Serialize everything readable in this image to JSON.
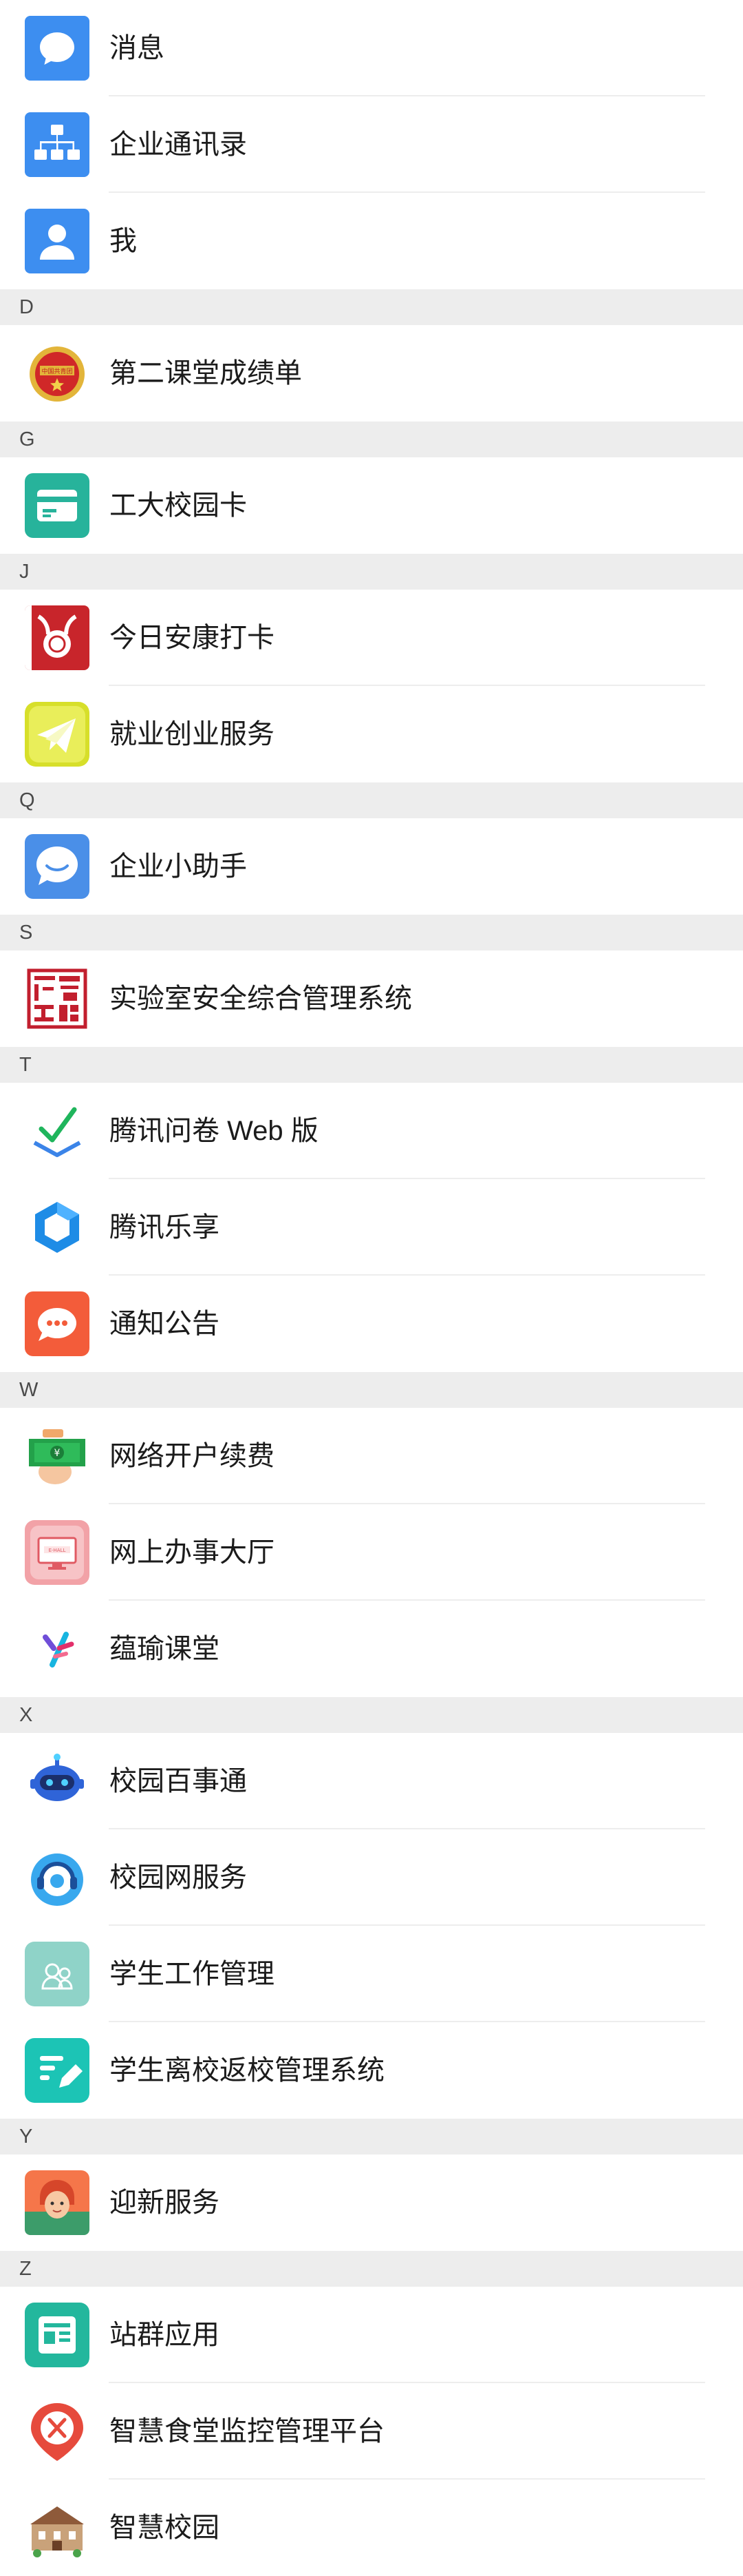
{
  "sections": [
    {
      "letter": "",
      "items": [
        {
          "label": "消息",
          "icon": "message-icon"
        },
        {
          "label": "企业通讯录",
          "icon": "org-chart-icon"
        },
        {
          "label": "我",
          "icon": "user-icon"
        }
      ]
    },
    {
      "letter": "D",
      "items": [
        {
          "label": "第二课堂成绩单",
          "icon": "youth-league-badge-icon"
        }
      ]
    },
    {
      "letter": "G",
      "items": [
        {
          "label": "工大校园卡",
          "icon": "campus-card-icon"
        }
      ]
    },
    {
      "letter": "J",
      "items": [
        {
          "label": "今日安康打卡",
          "icon": "health-checkin-icon"
        },
        {
          "label": "就业创业服务",
          "icon": "paper-plane-icon"
        }
      ]
    },
    {
      "letter": "Q",
      "items": [
        {
          "label": "企业小助手",
          "icon": "assistant-bubble-icon"
        }
      ]
    },
    {
      "letter": "S",
      "items": [
        {
          "label": "实验室安全综合管理系统",
          "icon": "lab-seal-icon"
        }
      ]
    },
    {
      "letter": "T",
      "items": [
        {
          "label": "腾讯问卷 Web 版",
          "icon": "survey-check-icon"
        },
        {
          "label": "腾讯乐享",
          "icon": "lexiang-hexagon-icon"
        },
        {
          "label": "通知公告",
          "icon": "announcement-bubble-icon"
        }
      ]
    },
    {
      "letter": "W",
      "items": [
        {
          "label": "网络开户续费",
          "icon": "payment-cash-icon"
        },
        {
          "label": "网上办事大厅",
          "icon": "online-hall-icon"
        },
        {
          "label": "蕴瑜课堂",
          "icon": "yunyu-logo-icon"
        }
      ]
    },
    {
      "letter": "X",
      "items": [
        {
          "label": "校园百事通",
          "icon": "robot-icon"
        },
        {
          "label": "校园网服务",
          "icon": "headset-icon"
        },
        {
          "label": "学生工作管理",
          "icon": "student-work-icon"
        },
        {
          "label": "学生离校返校管理系统",
          "icon": "form-edit-icon"
        }
      ]
    },
    {
      "letter": "Y",
      "items": [
        {
          "label": "迎新服务",
          "icon": "welcome-avatar-icon"
        }
      ]
    },
    {
      "letter": "Z",
      "items": [
        {
          "label": "站群应用",
          "icon": "site-group-icon"
        },
        {
          "label": "智慧食堂监控管理平台",
          "icon": "canteen-icon"
        },
        {
          "label": "智慧校园",
          "icon": "smart-campus-icon"
        }
      ]
    }
  ]
}
